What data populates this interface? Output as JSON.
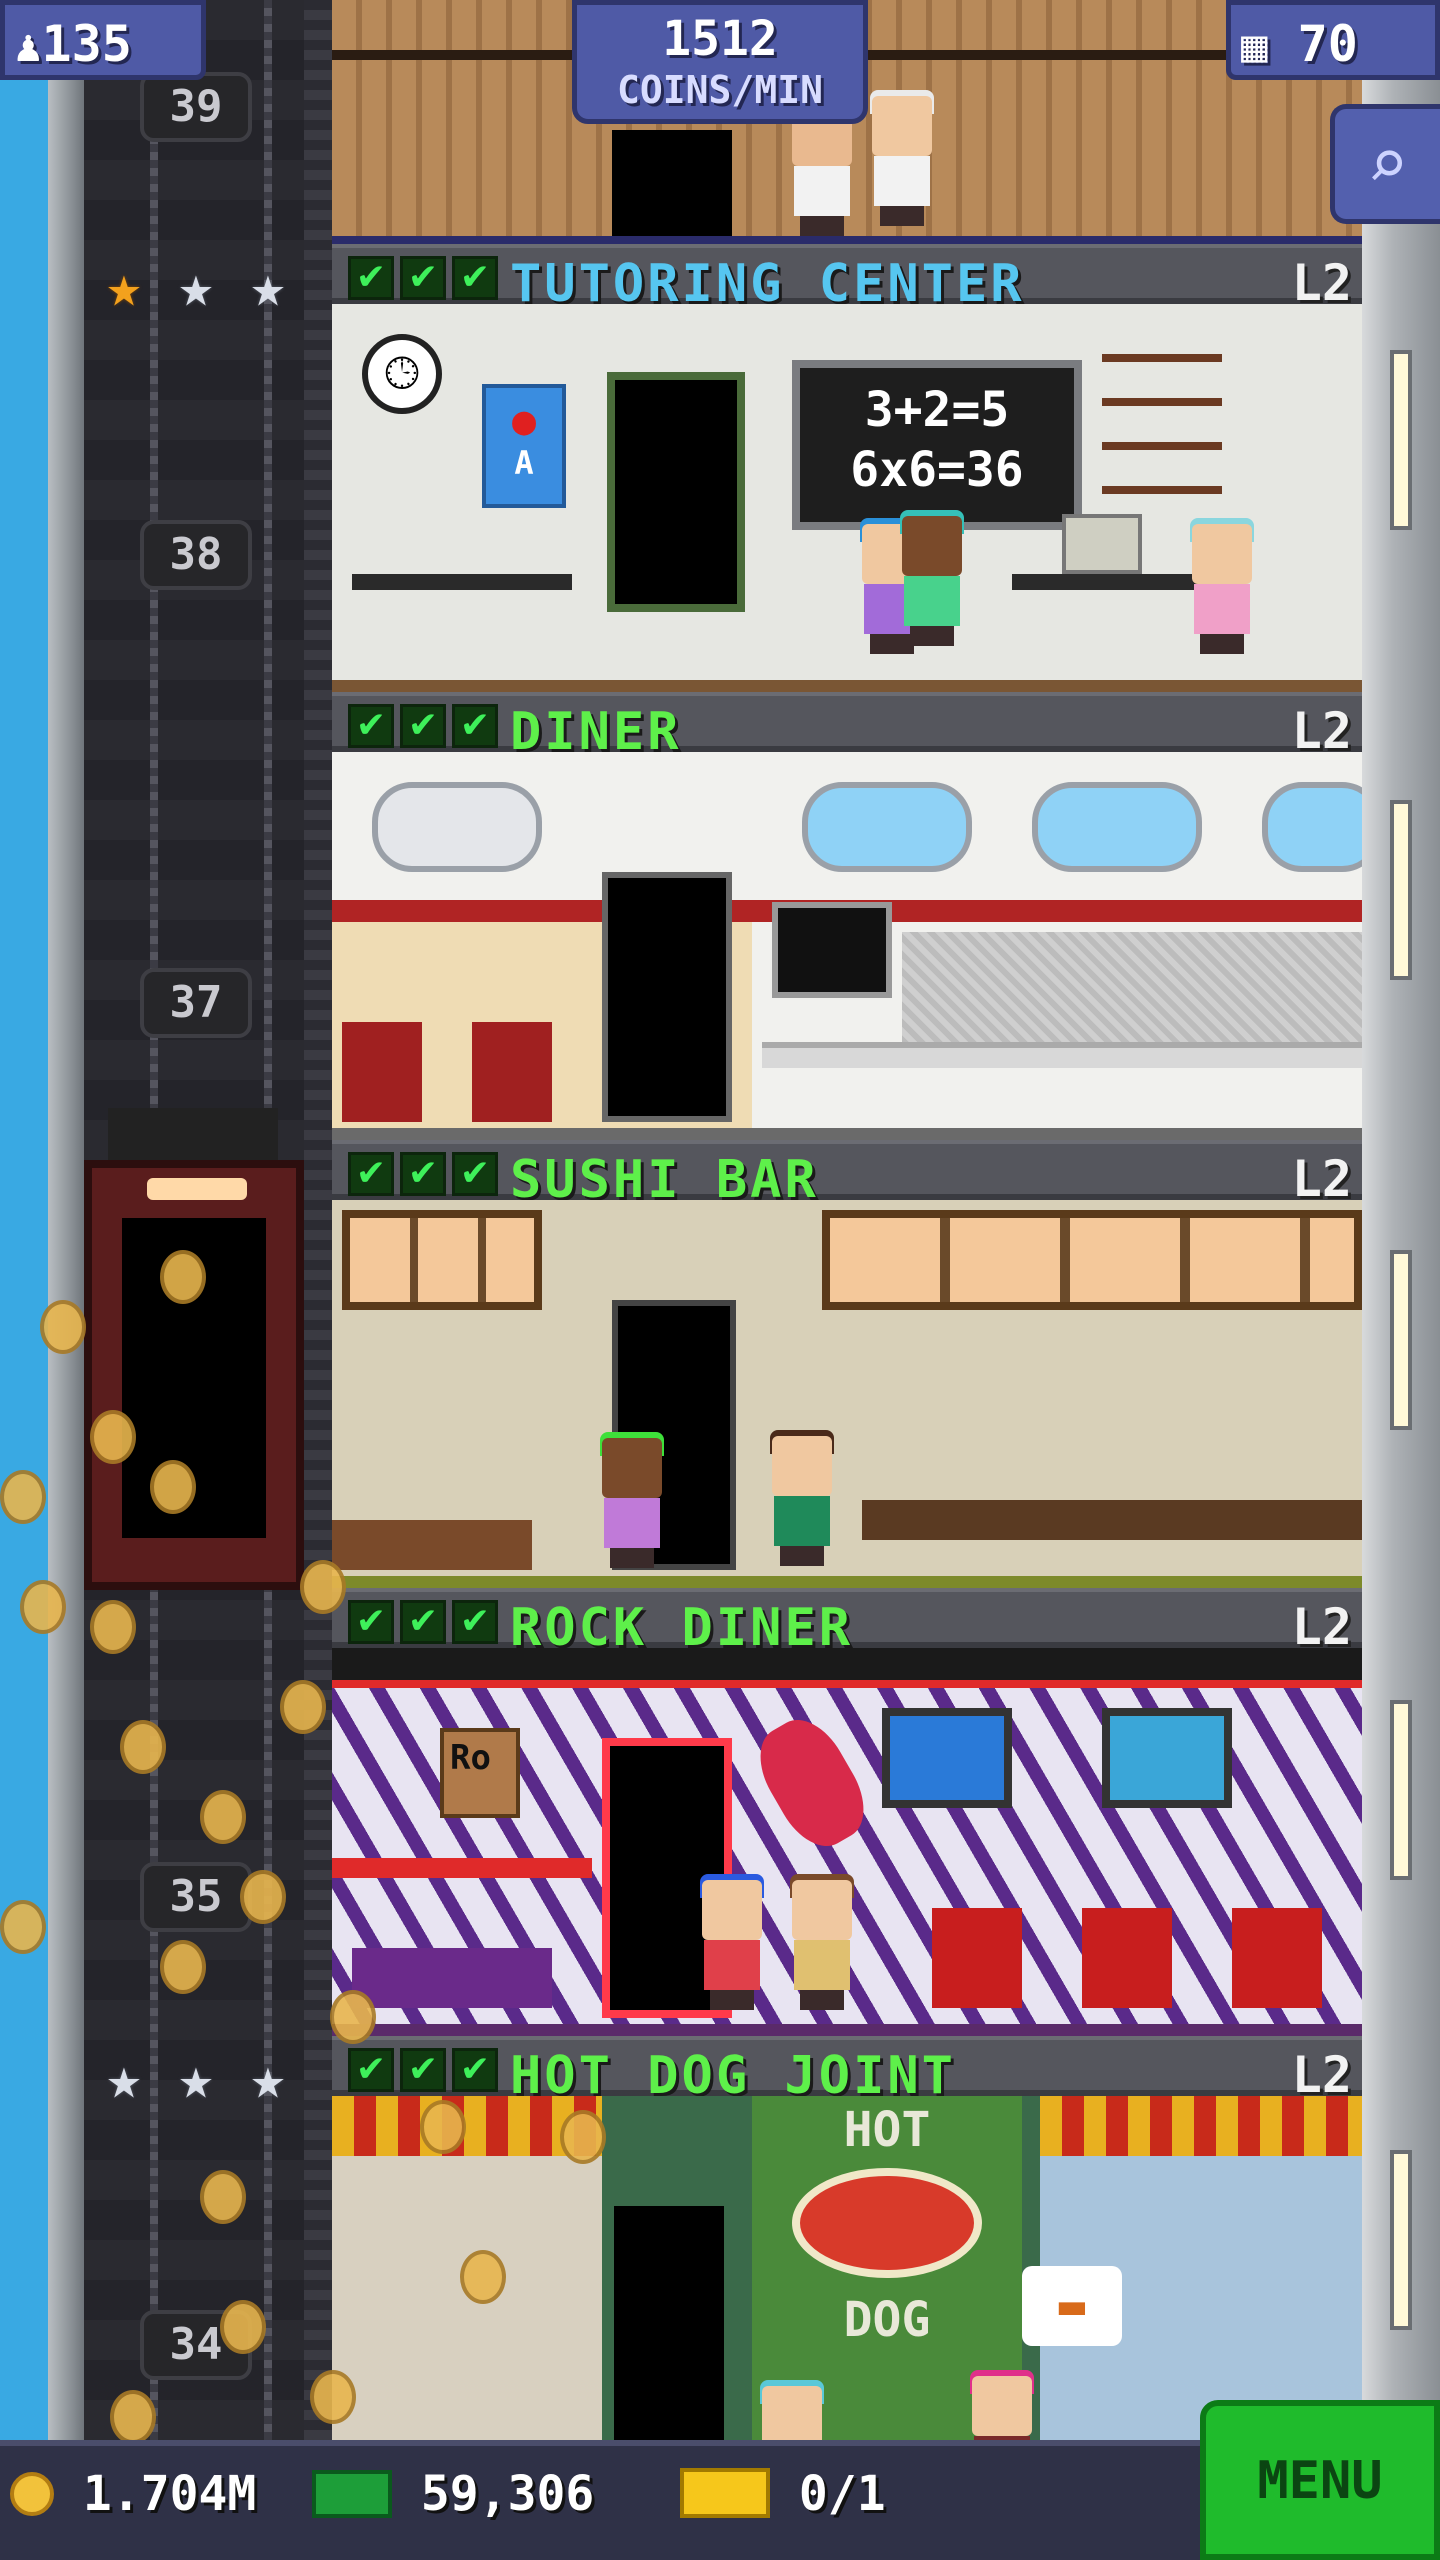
{
  "hud": {
    "population": "135",
    "coins_per_min_value": "1512",
    "coins_per_min_unit": "COINS/MIN",
    "floors": "70"
  },
  "icons": {
    "population": "person-icon",
    "floors": "building-icon",
    "search": "magnifier-icon",
    "coins": "coin-icon",
    "bux": "tower-bux-icon",
    "tickets": "golden-ticket-icon"
  },
  "shaft": {
    "floor_numbers": [
      "39",
      "38",
      "37",
      "35",
      "34"
    ]
  },
  "floors": [
    {
      "name": "TUTORING CENTER",
      "level": "L2",
      "name_color": "#56c6f0",
      "chalkboard": [
        "3+2=5",
        "6x6=36"
      ],
      "poster": "A"
    },
    {
      "name": "DINER",
      "level": "L2",
      "name_color": "#5ef04a"
    },
    {
      "name": "SUSHI BAR",
      "level": "L2",
      "name_color": "#5ef04a"
    },
    {
      "name": "ROCK DINER",
      "level": "L2",
      "name_color": "#5ef04a",
      "sign": "Ro"
    },
    {
      "name": "HOT DOG JOINT",
      "level": "L2",
      "name_color": "#5ef04a",
      "sign_top": "HOT",
      "sign_bottom": "DOG"
    }
  ],
  "bottom": {
    "coins": "1.704M",
    "bux": "59,306",
    "tickets": "0/1",
    "menu": "MENU"
  },
  "colors": {
    "hud_blue": "#4f5aa6",
    "menu_green": "#1fbb2c",
    "check_green": "#3ef05a"
  }
}
